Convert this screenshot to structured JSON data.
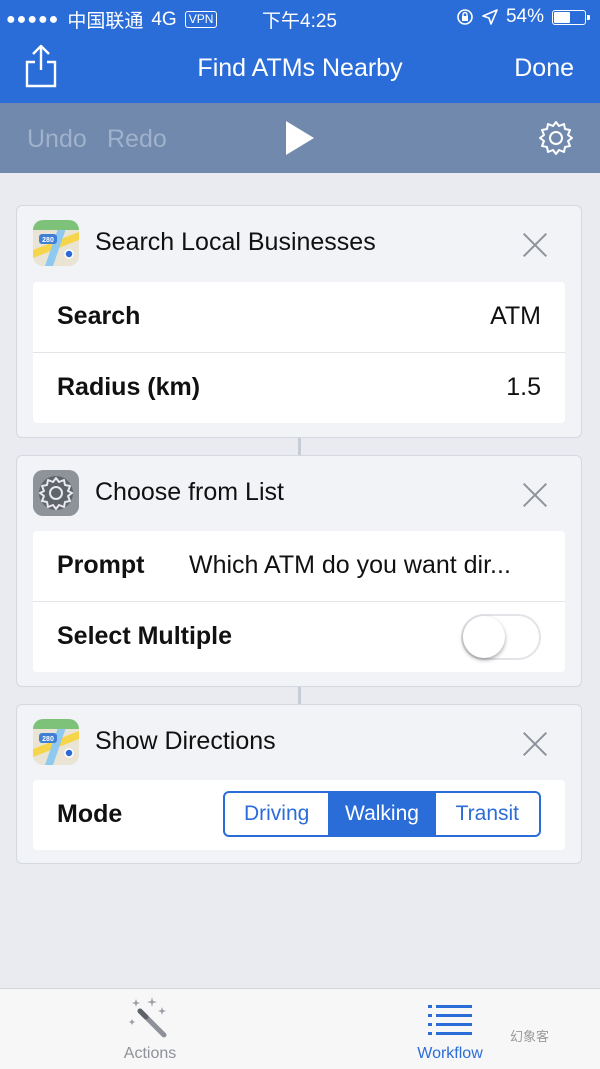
{
  "status_bar": {
    "signal": "●●●●●",
    "carrier": "中国联通",
    "network": "4G",
    "vpn": "VPN",
    "time": "下午4:25",
    "battery": "54%",
    "battery_level": 0.54
  },
  "nav": {
    "title": "Find ATMs Nearby",
    "done_label": "Done"
  },
  "toolbar": {
    "undo_label": "Undo",
    "redo_label": "Redo"
  },
  "cards": [
    {
      "title": "Search Local Businesses",
      "icon": "maps-icon",
      "rows": [
        {
          "label": "Search",
          "value": "ATM"
        },
        {
          "label": "Radius (km)",
          "value": "1.5"
        }
      ]
    },
    {
      "title": "Choose from List",
      "icon": "settings-icon",
      "rows": [
        {
          "label": "Prompt",
          "value": "Which ATM do you want dir..."
        },
        {
          "label": "Select Multiple",
          "toggle": false
        }
      ]
    },
    {
      "title": "Show Directions",
      "icon": "maps-icon",
      "rows": [
        {
          "label": "Mode",
          "segments": [
            "Driving",
            "Walking",
            "Transit"
          ],
          "selected": "Walking"
        }
      ]
    }
  ],
  "tabbar": {
    "actions_label": "Actions",
    "workflow_label": "Workflow",
    "active": "Workflow"
  },
  "watermark": "幻象客",
  "colors": {
    "accent": "#2b6dd8",
    "toolbar": "#7189ad",
    "background": "#e9ebf0"
  }
}
